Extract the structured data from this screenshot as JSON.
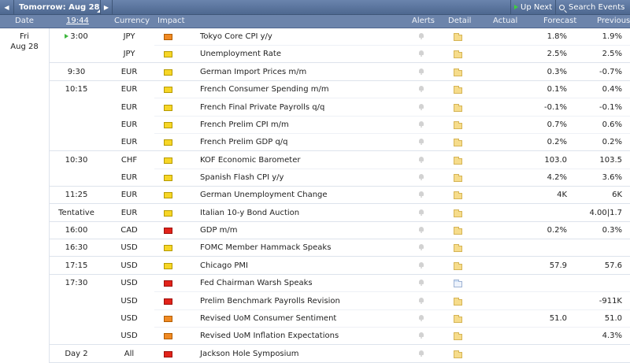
{
  "nav": {
    "title": "Tomorrow: Aug 28",
    "up_next": "Up Next",
    "search_events": "Search Events"
  },
  "columns": {
    "date": "Date",
    "time": "19:44",
    "currency": "Currency",
    "impact": "Impact",
    "alerts": "Alerts",
    "detail": "Detail",
    "actual": "Actual",
    "forecast": "Forecast",
    "previous": "Previous"
  },
  "day": {
    "weekday": "Fri",
    "date": "Aug 28"
  },
  "events": [
    {
      "time": "3:00",
      "currency": "JPY",
      "impact": "medium",
      "event": "Tokyo Core CPI y/y",
      "actual": "",
      "forecast": "1.8%",
      "previous": "1.9%"
    },
    {
      "time": "",
      "currency": "JPY",
      "impact": "low",
      "event": "Unemployment Rate",
      "actual": "",
      "forecast": "2.5%",
      "previous": "2.5%"
    },
    {
      "time": "9:30",
      "currency": "EUR",
      "impact": "low",
      "event": "German Import Prices m/m",
      "actual": "",
      "forecast": "0.3%",
      "previous": "-0.7%"
    },
    {
      "time": "10:15",
      "currency": "EUR",
      "impact": "low",
      "event": "French Consumer Spending m/m",
      "actual": "",
      "forecast": "0.1%",
      "previous": "0.4%"
    },
    {
      "time": "",
      "currency": "EUR",
      "impact": "low",
      "event": "French Final Private Payrolls q/q",
      "actual": "",
      "forecast": "-0.1%",
      "previous": "-0.1%"
    },
    {
      "time": "",
      "currency": "EUR",
      "impact": "low",
      "event": "French Prelim CPI m/m",
      "actual": "",
      "forecast": "0.7%",
      "previous": "0.6%"
    },
    {
      "time": "",
      "currency": "EUR",
      "impact": "low",
      "event": "French Prelim GDP q/q",
      "actual": "",
      "forecast": "0.2%",
      "previous": "0.2%"
    },
    {
      "time": "10:30",
      "currency": "CHF",
      "impact": "low",
      "event": "KOF Economic Barometer",
      "actual": "",
      "forecast": "103.0",
      "previous": "103.5"
    },
    {
      "time": "",
      "currency": "EUR",
      "impact": "low",
      "event": "Spanish Flash CPI y/y",
      "actual": "",
      "forecast": "4.2%",
      "previous": "3.6%"
    },
    {
      "time": "11:25",
      "currency": "EUR",
      "impact": "low",
      "event": "German Unemployment Change",
      "actual": "",
      "forecast": "4K",
      "previous": "6K"
    },
    {
      "time": "Tentative",
      "currency": "EUR",
      "impact": "low",
      "event": "Italian 10-y Bond Auction",
      "actual": "",
      "forecast": "",
      "previous": "4.00|1.7"
    },
    {
      "time": "16:00",
      "currency": "CAD",
      "impact": "high",
      "event": "GDP m/m",
      "actual": "",
      "forecast": "0.2%",
      "previous": "0.3%"
    },
    {
      "time": "16:30",
      "currency": "USD",
      "impact": "low",
      "event": "FOMC Member Hammack Speaks",
      "actual": "",
      "forecast": "",
      "previous": ""
    },
    {
      "time": "17:15",
      "currency": "USD",
      "impact": "low",
      "event": "Chicago PMI",
      "actual": "",
      "forecast": "57.9",
      "previous": "57.6"
    },
    {
      "time": "17:30",
      "currency": "USD",
      "impact": "high",
      "event": "Fed Chairman Warsh Speaks",
      "actual": "",
      "forecast": "",
      "previous": ""
    },
    {
      "time": "",
      "currency": "USD",
      "impact": "high",
      "event": "Prelim Benchmark Payrolls Revision",
      "actual": "",
      "forecast": "",
      "previous": "-911K"
    },
    {
      "time": "",
      "currency": "USD",
      "impact": "medium",
      "event": "Revised UoM Consumer Sentiment",
      "actual": "",
      "forecast": "51.0",
      "previous": "51.0"
    },
    {
      "time": "",
      "currency": "USD",
      "impact": "medium",
      "event": "Revised UoM Inflation Expectations",
      "actual": "",
      "forecast": "",
      "previous": "4.3%"
    },
    {
      "time": "Day 2",
      "currency": "All",
      "impact": "high",
      "event": "Jackson Hole Symposium",
      "actual": "",
      "forecast": "",
      "previous": ""
    }
  ],
  "icons": {
    "impact": "impact-folder-icon",
    "alert": "bell-icon",
    "detail": "folder-icon"
  },
  "colors": {
    "header": "#6c84ab",
    "impact_low": "#f7d627",
    "impact_medium": "#f08a24",
    "impact_high": "#e2231a"
  }
}
